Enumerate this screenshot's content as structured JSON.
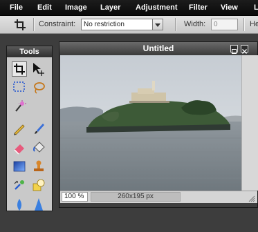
{
  "menu": {
    "items": [
      "File",
      "Edit",
      "Image",
      "Layer",
      "Adjustment",
      "Filter",
      "View",
      "L"
    ]
  },
  "options": {
    "constraint_label": "Constraint:",
    "constraint_value": "No restriction",
    "width_label": "Width:",
    "width_value": "0",
    "height_label": "He"
  },
  "tools": {
    "title": "Tools",
    "items": [
      "crop-icon",
      "move-icon",
      "marquee-icon",
      "lasso-icon",
      "magic-wand-icon",
      "pencil-icon",
      "brush-icon",
      "eraser-icon",
      "fill-bucket-icon",
      "gradient-icon",
      "stamp-icon",
      "color-replace-icon",
      "shape-icon",
      "blur-icon",
      "sharpen-icon"
    ]
  },
  "document": {
    "title": "Untitled",
    "zoom": "100 %",
    "size": "260x195 px"
  }
}
